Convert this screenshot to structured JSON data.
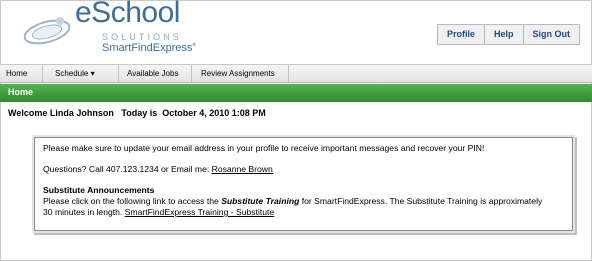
{
  "logo": {
    "brand": "eSchool",
    "sub": "SOLUTIONS",
    "product": "SmartFindExpress",
    "trademark": "®"
  },
  "top_nav": [
    "Profile",
    "Help",
    "Sign Out"
  ],
  "menu": {
    "home": "Home",
    "schedule": "Schedule ▾",
    "available_jobs": "Available Jobs",
    "review_assignments": "Review Assignments"
  },
  "section_title": "Home",
  "welcome": {
    "greeting": "Welcome Linda Johnson",
    "today": "Today is  October 4, 2010 1:08 PM"
  },
  "notice": {
    "update_msg": "Please make sure to update your email address in your profile to receive important messages and recover your PIN!",
    "questions_prefix": "Questions? Call 407.123.1234 or Email me: ",
    "email_link": "Rosanne Brown",
    "announce_title": "Substitute Announcements",
    "announce_line1_a": "Please click on the following link to access the ",
    "announce_line1_b": "Substitute Training",
    "announce_line1_c": " for SmartFindExpress. The Substitute Training is approximately",
    "announce_line2": "30 minutes in length. ",
    "training_link": "SmartFindExpress Training - Substitute"
  },
  "colors": {
    "green": "#3a9a3a",
    "brand_blue": "#3e6d97",
    "nav_text": "#1f4a86"
  }
}
